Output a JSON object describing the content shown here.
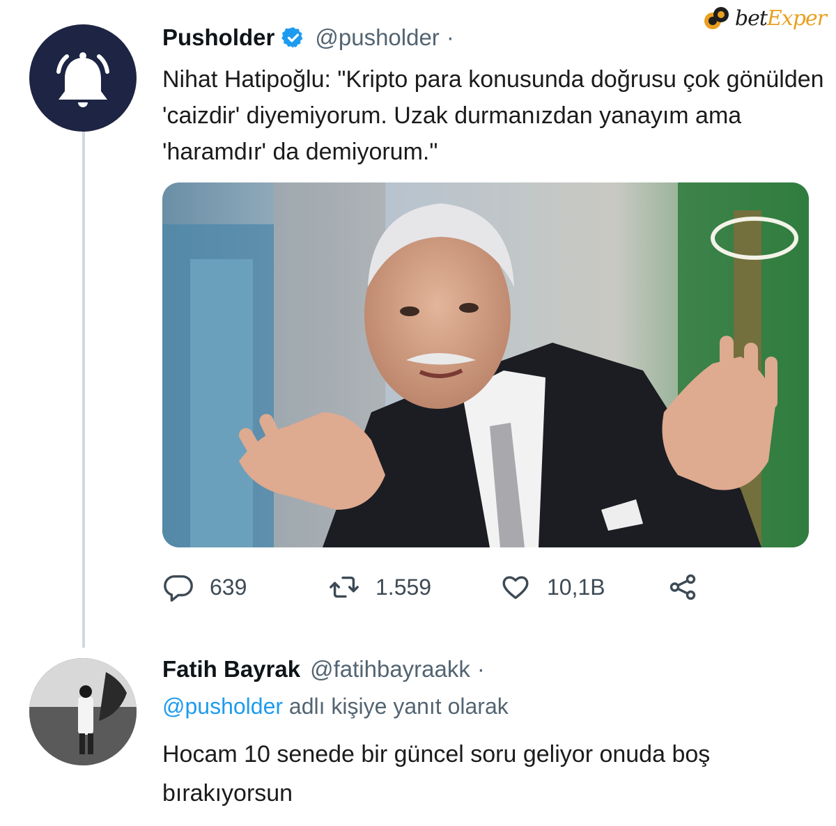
{
  "watermark": {
    "text_part1": "bet",
    "text_part2": "Exper",
    "logo_icon": "poker-chip-icon"
  },
  "tweet": {
    "author_name": "Pusholder",
    "author_handle": "@pusholder",
    "dot": "·",
    "verified_icon": "verified-badge-icon",
    "avatar_icon": "bell-icon",
    "text": "Nihat Hatipoğlu: \"Kripto para konusunda doğrusu çok gönülden 'caizdir' diyemiyorum. Uzak durmanızdan yanayım ama 'haramdır' da demiyorum.\"",
    "media_icon": "photo-of-speaker",
    "actions": {
      "reply_count": "639",
      "retweet_count": "1.559",
      "like_count": "10,1B"
    },
    "action_icons": [
      "reply-icon",
      "retweet-icon",
      "like-icon",
      "share-icon"
    ]
  },
  "reply": {
    "author_name": "Fatih Bayrak",
    "author_handle": "@fatihbayraakk",
    "dot": "·",
    "context_mention": "@pusholder",
    "context_suffix": " adlı kişiye yanıt olarak",
    "text": "Hocam 10 senede bir güncel soru geliyor onuda boş bırakıyorsun"
  },
  "colors": {
    "accent": "#1d9bf0",
    "avatar_bg": "#1e2443",
    "muted": "#536471",
    "thread_line": "#cfd9de"
  }
}
